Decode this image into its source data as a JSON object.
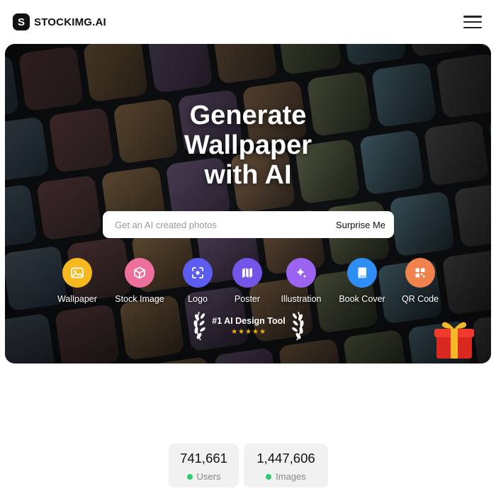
{
  "header": {
    "brand_mark": "S",
    "brand_name": "STOCKIMG.AI",
    "menu_icon": "hamburger-menu-icon"
  },
  "hero": {
    "headline": [
      "Generate",
      "Wallpaper",
      "with AI"
    ],
    "search": {
      "placeholder": "Get an AI created photos",
      "value": "",
      "surprise_label": "Surprise Me"
    },
    "categories": [
      {
        "label": "Wallpaper",
        "icon": "image-icon",
        "color": "#f6b81f"
      },
      {
        "label": "Stock Image",
        "icon": "cube-icon",
        "color": "#ec6f9c"
      },
      {
        "label": "Logo",
        "icon": "scan-icon",
        "color": "#5c5cf0"
      },
      {
        "label": "Poster",
        "icon": "map-icon",
        "color": "#7355ea"
      },
      {
        "label": "Illustration",
        "icon": "sparkle-icon",
        "color": "#9b63f0"
      },
      {
        "label": "Book Cover",
        "icon": "book-icon",
        "color": "#2f8ef4"
      },
      {
        "label": "QR Code",
        "icon": "qr-code-icon",
        "color": "#f0824e"
      }
    ],
    "badge": {
      "title": "#1 AI Design Tool",
      "stars": "★★★★★",
      "rating": 5
    },
    "gift_icon": "gift-box-icon"
  },
  "stats": [
    {
      "value": "741,661",
      "label": "Users",
      "status_color": "#2ecc71"
    },
    {
      "value": "1,447,606",
      "label": "Images",
      "status_color": "#2ecc71"
    }
  ]
}
